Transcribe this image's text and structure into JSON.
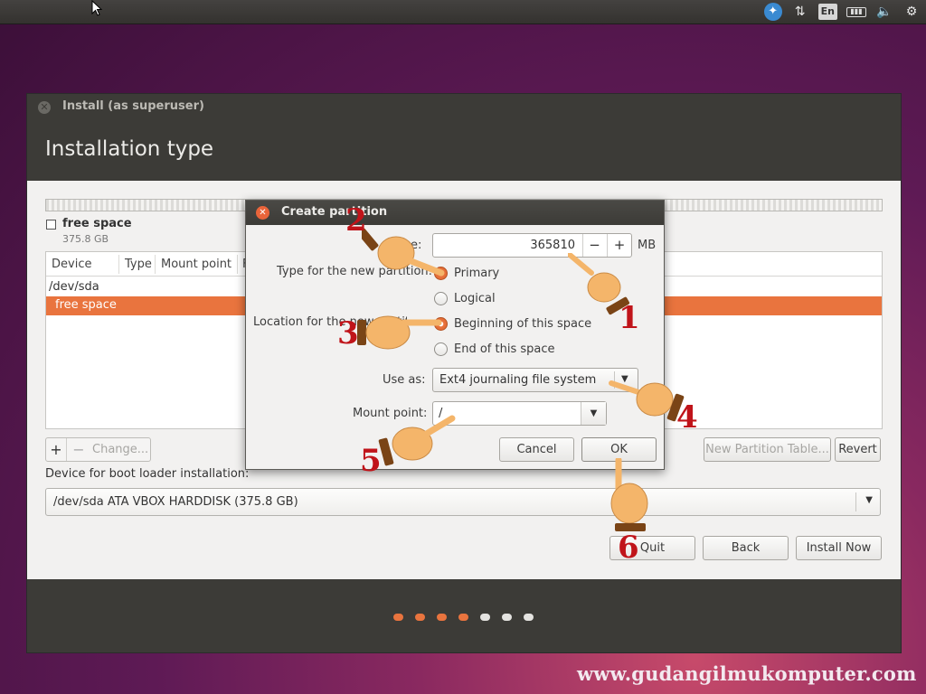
{
  "topbar": {
    "tray_language": "En"
  },
  "window": {
    "title": "Install (as superuser)",
    "page_title": "Installation type"
  },
  "partition_overview": {
    "label": "free space",
    "size": "375.8 GB"
  },
  "partition_table": {
    "columns": [
      "Device",
      "Type",
      "Mount point",
      "F"
    ],
    "rows": [
      {
        "device": "/dev/sda"
      },
      {
        "device": "free space",
        "selected": true
      }
    ]
  },
  "table_actions": {
    "add": "+",
    "remove": "−",
    "change": "Change..."
  },
  "new_partition_table_button": "New Partition Table...",
  "revert_button": "Revert",
  "boot_loader": {
    "label": "Device for boot loader installation:",
    "value": "/dev/sda ATA VBOX HARDDISK (375.8 GB)"
  },
  "nav_buttons": {
    "quit": "Quit",
    "back": "Back",
    "install_now": "Install Now"
  },
  "progress": {
    "steps_total": 7,
    "steps_done": 4,
    "active_color": "#e9743e"
  },
  "dialog": {
    "title": "Create partition",
    "size_label_partial": "e:",
    "size_value": "365810",
    "size_unit": "MB",
    "size_minus": "−",
    "size_plus": "+",
    "type_label": "Type for the new partition:",
    "type_options": [
      "Primary",
      "Logical"
    ],
    "type_selected": "Primary",
    "location_label": "Location for the new partition:",
    "location_options": [
      "Beginning of this space",
      "End of this space"
    ],
    "location_selected": "Beginning of this space",
    "use_as_label": "Use as:",
    "use_as_value": "Ext4 journaling file system",
    "mount_label": "Mount point:",
    "mount_value": "/",
    "cancel_label": "Cancel",
    "ok_label": "OK"
  },
  "annotations": {
    "numbers": [
      "1",
      "2",
      "3",
      "4",
      "5",
      "6"
    ],
    "hand_color": "#f4b56a",
    "cuff_color": "#7a4416",
    "number_color": "#c0141a"
  },
  "watermark": "www.gudangilmukomputer.com",
  "colors": {
    "selection": "#e9743e",
    "header_bg": "#3c3b37"
  }
}
